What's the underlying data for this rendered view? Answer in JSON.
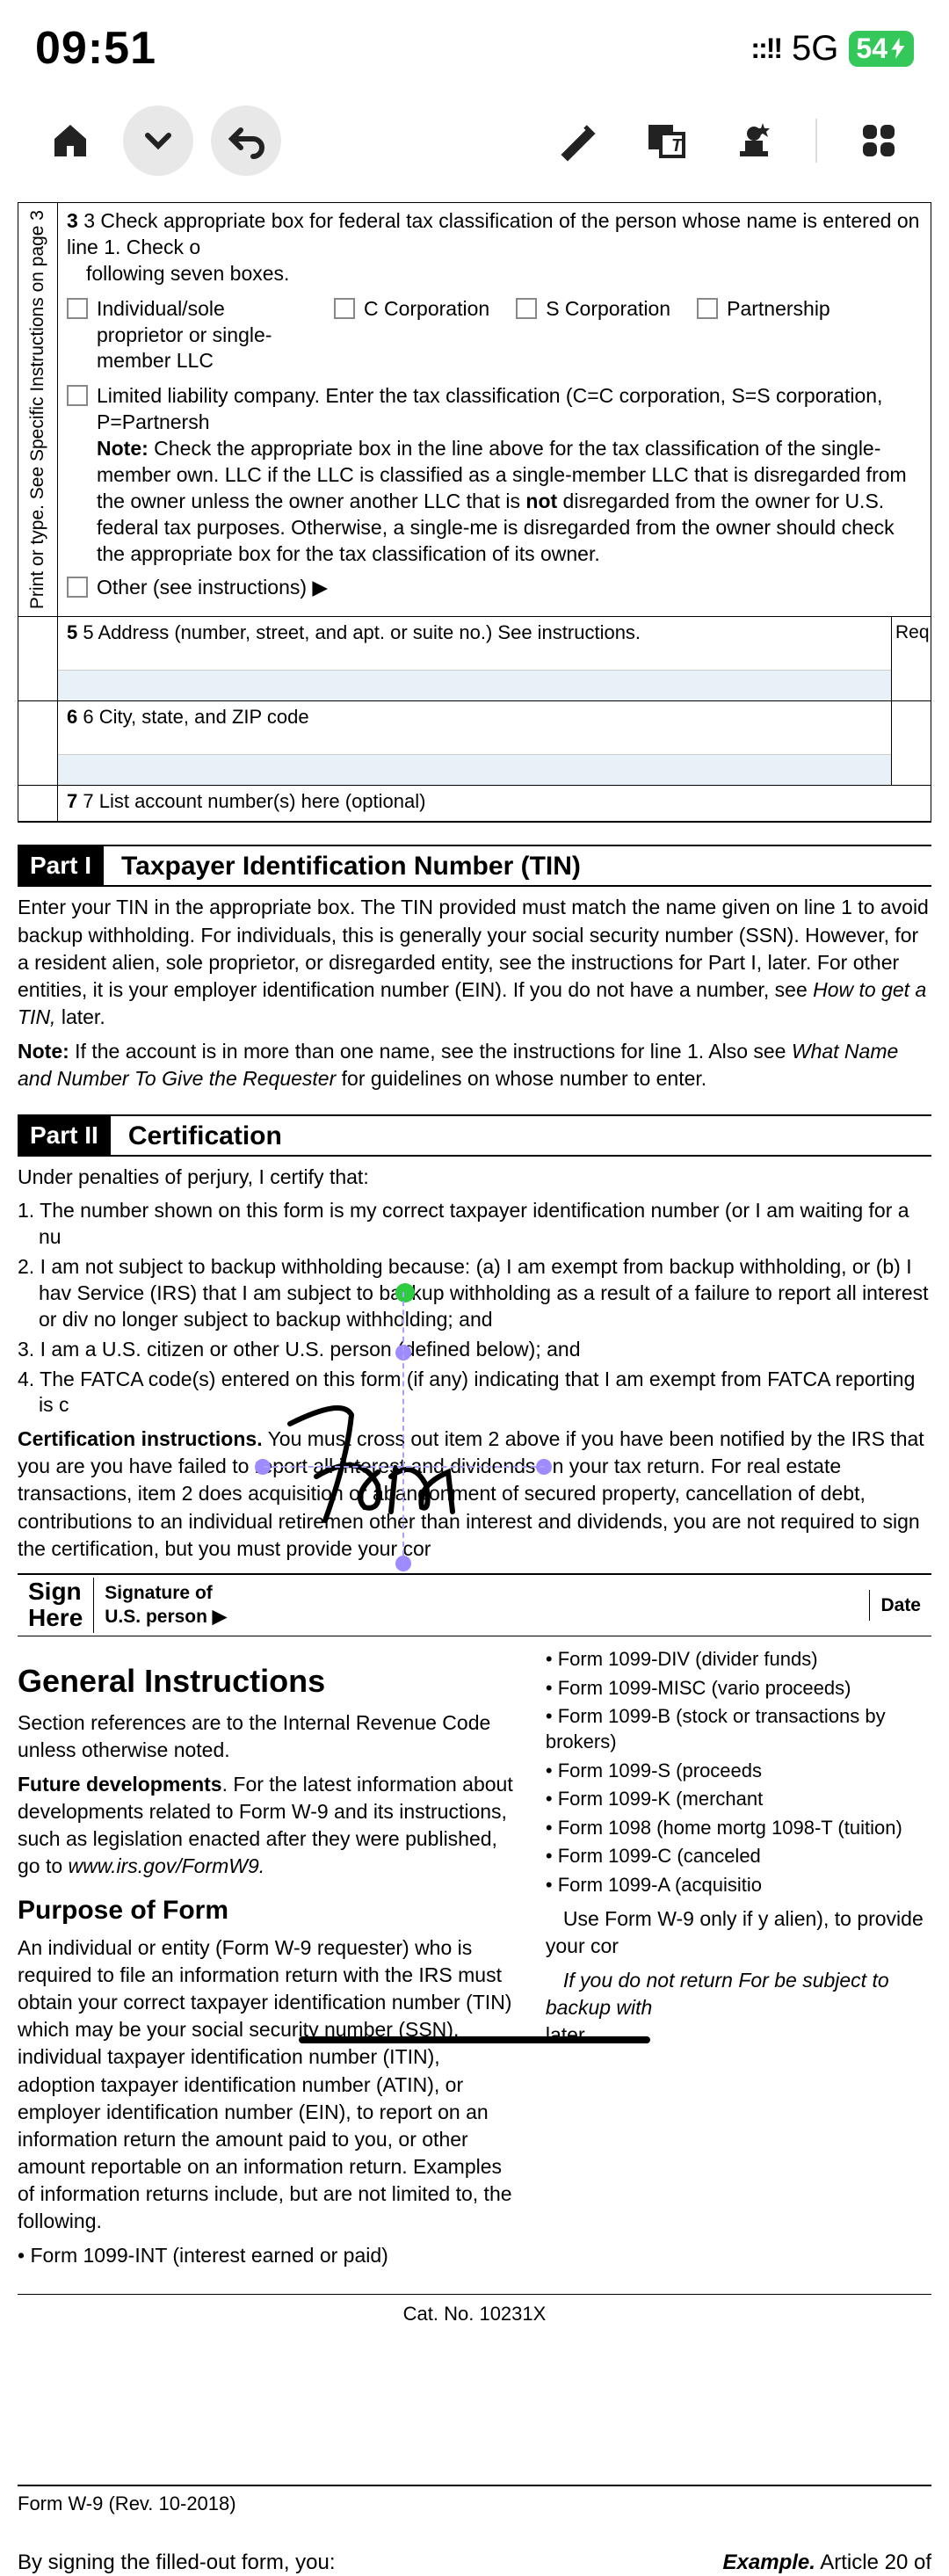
{
  "status": {
    "time": "09:51",
    "signal": "::!!",
    "network": "5G",
    "battery": "54"
  },
  "form": {
    "sidebar_text": "Print or type. See Specific Instructions on page 3",
    "line3_intro": "3 Check appropriate box for federal tax classification of the person whose name is entered on line 1. Check o",
    "line3_intro2": "following seven boxes.",
    "cb_individual": "Individual/sole proprietor or single-member LLC",
    "cb_ccorp": "C Corporation",
    "cb_scorp": "S Corporation",
    "cb_partnership": "Partnership",
    "cb_llc": "Limited liability company. Enter the tax classification (C=C corporation, S=S corporation, P=Partnersh",
    "llc_note_bold": "Note:",
    "llc_note": " Check the appropriate box in the line above for the tax classification of the single-member own. LLC if the LLC is classified as a single-member LLC that is disregarded from the owner unless the owner another LLC that is ",
    "llc_note_not": "not",
    "llc_note2": " disregarded from the owner for U.S. federal tax purposes. Otherwise, a single-me is disregarded from the owner should check the appropriate box for the tax classification of its owner.",
    "cb_other": "Other (see instructions) ▶",
    "line5": "5 Address (number, street, and apt. or suite no.) See instructions.",
    "line5_right": "Req",
    "line6": "6 City, state, and ZIP code",
    "line7": "7 List account number(s) here (optional)"
  },
  "part1": {
    "badge": "Part I",
    "title": "Taxpayer Identification Number (TIN)",
    "p1": "Enter your TIN in the appropriate box. The TIN provided must match the name given on line 1 to avoid backup withholding. For individuals, this is generally your social security number (SSN). However, for a resident alien, sole proprietor, or disregarded entity, see the instructions for Part I, later. For other entities, it is your employer identification number (EIN). If you do not have a number, see ",
    "p1_italic": "How to get a TIN,",
    "p1_end": " later.",
    "note_bold": "Note:",
    "note": " If the account is in more than one name, see the instructions for line 1. Also see ",
    "note_italic": "What Name and Number To Give the Requester",
    "note_end": " for guidelines on whose number to enter."
  },
  "part2": {
    "badge": "Part II",
    "title": "Certification",
    "intro": "Under penalties of perjury, I certify that:",
    "item1": "1. The number shown on this form is my correct taxpayer identification number (or I am waiting for a nu",
    "item2": "2. I am not subject to backup withholding because: (a) I am exempt from backup withholding, or (b) I hav Service (IRS) that I am subject to backup withholding as a result of a failure to report all interest or div no longer subject to backup withholding; and",
    "item3": "3. I am a U.S. citizen or other U.S. person (defined below); and",
    "item4": "4. The FATCA code(s) entered on this form (if any) indicating that I am exempt from FATCA reporting is c",
    "cert_bold": "Certification instructions.",
    "cert": " You must cross out item 2 above if you have been notified by the IRS that you are you have failed to report all interest and dividends on your tax return. For real estate transactions, item 2 does acquisition or abandonment of secured property, cancellation of debt, contributions to an individual retiremen other than interest and dividends, you are not required to sign the certification, but you must provide your cor"
  },
  "sign": {
    "here1": "Sign",
    "here2": "Here",
    "label1": "Signature of",
    "label2": "U.S. person ▶",
    "date": "Date "
  },
  "general": {
    "title": "General Instructions",
    "p1": "Section references are to the Internal Revenue Code unless otherwise noted.",
    "future_bold": "Future developments",
    "future": ". For the latest information about developments related to Form W-9 and its instructions, such as legislation enacted after they were published, go to ",
    "future_italic": "www.irs.gov/FormW9.",
    "purpose_title": "Purpose of Form",
    "purpose": "An individual or entity (Form W-9 requester) who is required to file an information return with the IRS must obtain your correct taxpayer identification number (TIN) which may be your social security number (SSN), individual taxpayer identification number (ITIN), adoption taxpayer identification number (ATIN), or employer identification number (EIN), to report on an information return the amount paid to you, or other amount reportable on an information return. Examples of information returns include, but are not limited to, the following.",
    "b_left": "• Form 1099-INT (interest earned or paid)",
    "b1": "• Form 1099-DIV (divider funds)",
    "b2": "• Form 1099-MISC (vario proceeds)",
    "b3": "• Form 1099-B (stock or transactions by brokers)",
    "b4": "• Form 1099-S (proceeds",
    "b5": "• Form 1099-K (merchant",
    "b6": "• Form 1098 (home mortg 1098-T (tuition)",
    "b7": "• Form 1099-C (canceled",
    "b8": "• Form 1099-A (acquisitio",
    "use": "Use Form W-9 only if y alien), to provide your cor",
    "ifnot_italic": "If you do not return For be subject to backup with",
    "later": " later."
  },
  "footer": {
    "cat": "Cat. No. 10231X",
    "rev": "Form W-9 (Rev. 10-2018)",
    "signing": "By signing the filled-out form, you:",
    "example_bold": "Example.",
    "example": " Article 20 of"
  }
}
